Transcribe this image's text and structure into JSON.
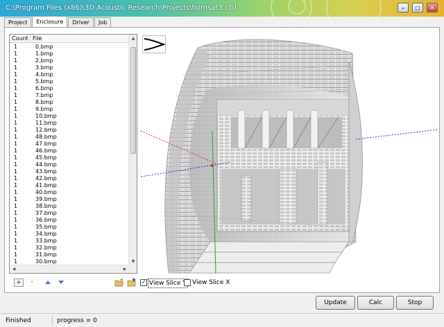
{
  "window": {
    "title": "C:\\Program Files (x86)\\3D Acoustic Research\\Projects\\hornsat3.r3d",
    "minimize": "–",
    "maximize": "□",
    "close": "✕"
  },
  "tabs": [
    {
      "label": "Project"
    },
    {
      "label": "Enclosure"
    },
    {
      "label": "Driver"
    },
    {
      "label": "Job"
    }
  ],
  "list": {
    "headers": {
      "count": "Count",
      "file": "File"
    },
    "rows": [
      {
        "count": "1",
        "file": "0.bmp"
      },
      {
        "count": "1",
        "file": "1.bmp"
      },
      {
        "count": "1",
        "file": "2.bmp"
      },
      {
        "count": "1",
        "file": "3.bmp"
      },
      {
        "count": "1",
        "file": "4.bmp"
      },
      {
        "count": "1",
        "file": "5.bmp"
      },
      {
        "count": "1",
        "file": "6.bmp"
      },
      {
        "count": "1",
        "file": "7.bmp"
      },
      {
        "count": "1",
        "file": "8.bmp"
      },
      {
        "count": "1",
        "file": "9.bmp"
      },
      {
        "count": "1",
        "file": "10.bmp"
      },
      {
        "count": "1",
        "file": "11.bmp"
      },
      {
        "count": "1",
        "file": "12.bmp"
      },
      {
        "count": "1",
        "file": "48.bmp"
      },
      {
        "count": "1",
        "file": "47.bmp"
      },
      {
        "count": "1",
        "file": "46.bmp"
      },
      {
        "count": "1",
        "file": "45.bmp"
      },
      {
        "count": "1",
        "file": "44.bmp"
      },
      {
        "count": "1",
        "file": "43.bmp"
      },
      {
        "count": "1",
        "file": "42.bmp"
      },
      {
        "count": "1",
        "file": "41.bmp"
      },
      {
        "count": "1",
        "file": "40.bmp"
      },
      {
        "count": "1",
        "file": "39.bmp"
      },
      {
        "count": "1",
        "file": "38.bmp"
      },
      {
        "count": "1",
        "file": "37.bmp"
      },
      {
        "count": "1",
        "file": "36.bmp"
      },
      {
        "count": "1",
        "file": "35.bmp"
      },
      {
        "count": "1",
        "file": "34.bmp"
      },
      {
        "count": "1",
        "file": "33.bmp"
      },
      {
        "count": "1",
        "file": "32.bmp"
      },
      {
        "count": "1",
        "file": "31.bmp"
      },
      {
        "count": "1",
        "file": "30.bmp"
      }
    ]
  },
  "list_toolbar": {
    "add": "+",
    "remove": "-"
  },
  "view_slice": {
    "y_label": "View Slice Y",
    "y_checked": true,
    "y_mark": "✓",
    "x_label": "View Slice X",
    "x_checked": false
  },
  "actions": {
    "update": "Update",
    "calc": "Calc",
    "stop": "Stop"
  },
  "status": {
    "state": "Finished",
    "progress": "progress = 0"
  },
  "colors": {
    "titlebar_accent": "#2aa8d8",
    "axis_x": "#cc3030",
    "axis_y": "#2aa030",
    "axis_z": "#2030c0",
    "model": "#dcdcdc"
  }
}
